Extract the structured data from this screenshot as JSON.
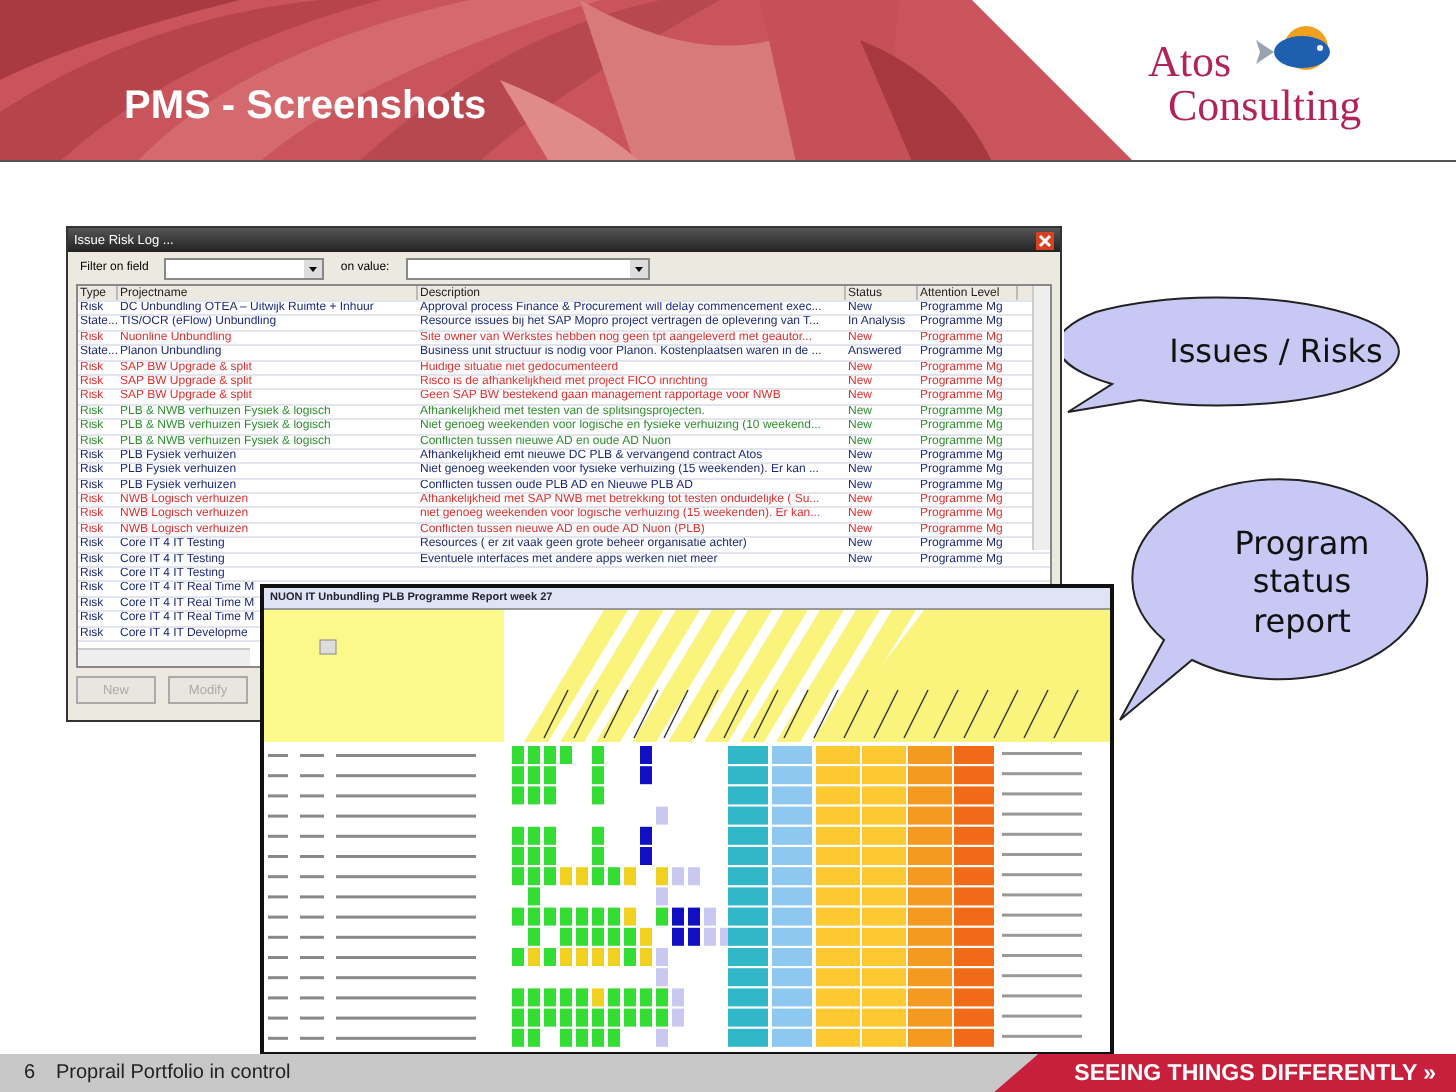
{
  "slide": {
    "title": "PMS - Screenshots",
    "logo": {
      "line_1": "Atos",
      "line_2": "Consulting"
    },
    "page_number": "6",
    "footer_text": "Proprail Portfolio in control",
    "tagline": "SEEING THINGS DIFFERENTLY »"
  },
  "issue_window": {
    "title": "Issue Risk Log ...",
    "filter_label": "Filter on field",
    "value_label": "on value:",
    "columns": [
      "Type",
      "Projectname",
      "Description",
      "Status",
      "Attention Level"
    ],
    "rows": [
      {
        "type": "Risk",
        "project": "DC Unbundling OTEA – Uitwijk Ruimte + Inhuur",
        "description": "Approval process Finance & Procurement will delay commencement exec...",
        "status": "New",
        "attention": "Programme Mg",
        "color": "#1c2a7a"
      },
      {
        "type": "State...",
        "project": "TIS/OCR (eFlow) Unbundling",
        "description": "Resource issues bij het SAP Mopro project vertragen de oplevering van T...",
        "status": "In Analysis",
        "attention": "Programme Mg",
        "color": "#1c2a7a"
      },
      {
        "type": "Risk",
        "project": "Nuonline Unbundling",
        "description": "Site owner van Werkstes hebben nog geen tpt aangeleverd met geautor...",
        "status": "New",
        "attention": "Programme Mg",
        "color": "#e03030"
      },
      {
        "type": "State...",
        "project": "Planon Unbundling",
        "description": "Business unit structuur is nodig voor Planon. Kostenplaatsen waren in de ...",
        "status": "Answered",
        "attention": "Programme Mg",
        "color": "#1c2a7a"
      },
      {
        "type": "Risk",
        "project": "SAP BW Upgrade & split",
        "description": "Huidige situatie niet gedocumenteerd",
        "status": "New",
        "attention": "Programme Mg",
        "color": "#e03030"
      },
      {
        "type": "Risk",
        "project": "SAP BW Upgrade & split",
        "description": "Risco is de afhankelijkheid met project FICO inrichting",
        "status": "New",
        "attention": "Programme Mg",
        "color": "#e03030"
      },
      {
        "type": "Risk",
        "project": "SAP BW Upgrade & split",
        "description": "Geen SAP BW bestekend gaan management rapportage voor NWB",
        "status": "New",
        "attention": "Programme Mg",
        "color": "#e03030"
      },
      {
        "type": "Risk",
        "project": "PLB & NWB verhuizen Fysiek & logisch",
        "description": "Afhankelijkheid met testen van de splitsingsprojecten.",
        "status": "New",
        "attention": "Programme Mg",
        "color": "#2f8f2f"
      },
      {
        "type": "Risk",
        "project": "PLB & NWB verhuizen Fysiek & logisch",
        "description": "Niet genoeg weekenden voor logische en fysieke verhuizing (10 weekend...",
        "status": "New",
        "attention": "Programme Mg",
        "color": "#2f8f2f"
      },
      {
        "type": "Risk",
        "project": "PLB & NWB verhuizen Fysiek & logisch",
        "description": "Conflicten tussen nieuwe AD en oude AD Nuon",
        "status": "New",
        "attention": "Programme Mg",
        "color": "#2f8f2f"
      },
      {
        "type": "Risk",
        "project": "PLB Fysiek verhuizen",
        "description": "Afhankelijkheid emt nieuwe DC PLB & vervangend contract Atos",
        "status": "New",
        "attention": "Programme Mg",
        "color": "#1c2a7a"
      },
      {
        "type": "Risk",
        "project": "PLB Fysiek verhuizen",
        "description": "Niet genoeg weekenden voor fysieke verhuizing (15 weekenden). Er kan ...",
        "status": "New",
        "attention": "Programme Mg",
        "color": "#1c2a7a"
      },
      {
        "type": "Risk",
        "project": "PLB Fysiek verhuizen",
        "description": "Conflicten tussen oude PLB AD en Nieuwe PLB AD",
        "status": "New",
        "attention": "Programme Mg",
        "color": "#1c2a7a"
      },
      {
        "type": "Risk",
        "project": "NWB Logisch verhuizen",
        "description": "Afhankelijkheid met SAP NWB met betrekking tot testen onduidelijke ( Su...",
        "status": "New",
        "attention": "Programme Mg",
        "color": "#e03030"
      },
      {
        "type": "Risk",
        "project": "NWB Logisch verhuizen",
        "description": "niet genoeg weekenden voor logische verhuizing (15 weekenden). Er kan...",
        "status": "New",
        "attention": "Programme Mg",
        "color": "#e03030"
      },
      {
        "type": "Risk",
        "project": "NWB Logisch verhuizen",
        "description": "Conflicten tussen nieuwe AD en oude AD Nuon (PLB)",
        "status": "New",
        "attention": "Programme Mg",
        "color": "#e03030"
      },
      {
        "type": "Risk",
        "project": "Core IT 4 IT Testing",
        "description": "Resources ( er zit vaak geen grote beheer organisatie achter)",
        "status": "New",
        "attention": "Programme Mg",
        "color": "#1c2a7a"
      },
      {
        "type": "Risk",
        "project": "Core IT 4 IT Testing",
        "description": "Eventuele interfaces met andere apps werken niet meer",
        "status": "New",
        "attention": "Programme Mg",
        "color": "#1c2a7a"
      },
      {
        "type": "Risk",
        "project": "Core IT 4 IT Testing",
        "color": "#1c2a7a"
      },
      {
        "type": "Risk",
        "project": "Core IT 4 IT Real Time M",
        "color": "#1c2a7a"
      },
      {
        "type": "Risk",
        "project": "Core IT 4 IT Real Time M",
        "color": "#1c2a7a"
      },
      {
        "type": "Risk",
        "project": "Core IT 4 IT Real Time M",
        "color": "#1c2a7a"
      },
      {
        "type": "Risk",
        "project": "Core IT 4 IT Developme",
        "color": "#1c2a7a"
      }
    ],
    "buttons": [
      {
        "label": "New",
        "disabled": true
      },
      {
        "label": "Modify",
        "disabled": true
      }
    ]
  },
  "report_window": {
    "title": "NUON IT Unbundling PLB Programme Report week 27"
  },
  "callouts": [
    "Issues / Risks",
    "Program status report"
  ]
}
